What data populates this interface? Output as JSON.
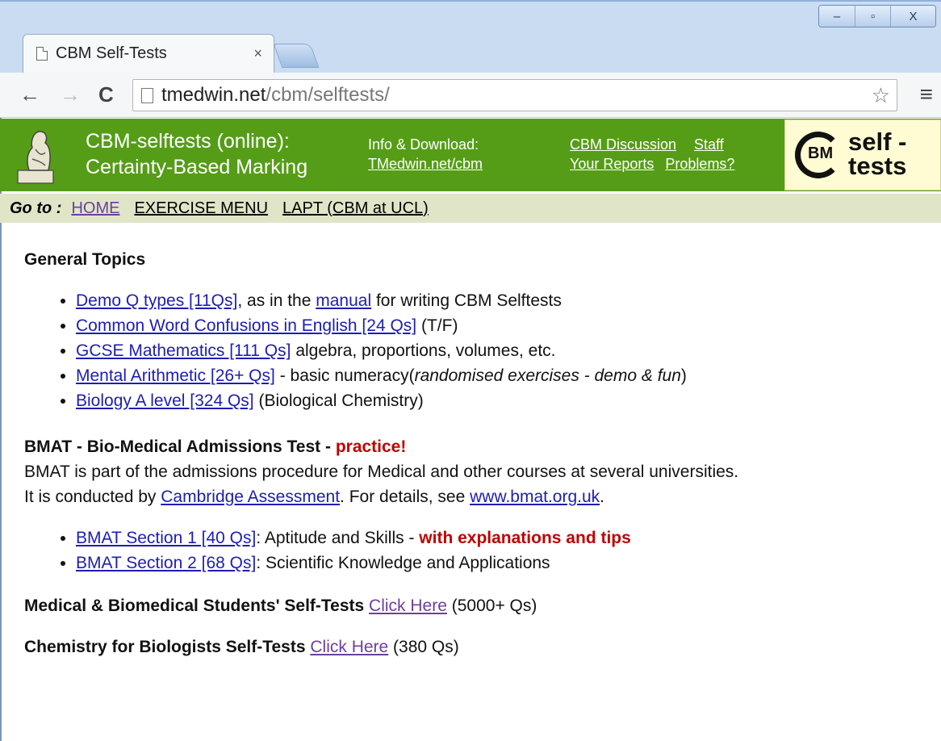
{
  "browser": {
    "tab_title": "CBM Self-Tests",
    "tab_close": "×",
    "url_host": "tmedwin.net",
    "url_path": "/cbm/selftests/",
    "window_controls": [
      "–",
      "▫",
      "X"
    ]
  },
  "header": {
    "title_line1": "CBM-selftests (online):",
    "title_line2": "Certainty-Based Marking",
    "info_label": "Info & Download:",
    "info_link": "TMedwin.net/cbm",
    "link_discussion": "CBM Discussion",
    "link_staff": "Staff",
    "link_reports": "Your Reports",
    "link_problems": "Problems?",
    "brand_bm": "BM",
    "brand_line1": "self -",
    "brand_line2": "tests"
  },
  "goto": {
    "label": "Go to :",
    "home": "HOME",
    "exercise_menu": "EXERCISE MENU",
    "lapt": "LAPT (CBM at UCL)"
  },
  "general": {
    "heading": "General Topics",
    "items": [
      {
        "link": "Demo Q types [11Qs]",
        "text1": ", as in the ",
        "link2": "manual",
        "text2": " for writing CBM Selftests"
      },
      {
        "link": "Common Word Confusions in English [24 Qs]",
        "text1": " (T/F)"
      },
      {
        "link": "GCSE Mathematics [111 Qs]",
        "text1": " algebra, proportions, volumes, etc."
      },
      {
        "link": "Mental Arithmetic [26+ Qs]",
        "text1": " - basic numeracy(",
        "italic": "randomised exercises - demo & fun",
        "text2": ")"
      },
      {
        "link": "Biology A level [324 Qs]",
        "text1": " (Biological Chemistry)"
      }
    ]
  },
  "bmat": {
    "heading": "BMAT - Bio-Medical Admissions Test - ",
    "heading_red": "practice!",
    "para_line1": "BMAT is part of the admissions procedure for Medical and other courses at several universities.",
    "para_line2_a": "It is conducted by ",
    "para_link1": "Cambridge Assessment",
    "para_line2_b": ". For details, see ",
    "para_link2": "www.bmat.org.uk",
    "para_line2_c": ".",
    "items": [
      {
        "link": "BMAT Section 1 [40 Qs]",
        "text1": ": Aptitude and Skills - ",
        "red": " with explanations and tips"
      },
      {
        "link": "BMAT Section 2 [68 Qs]",
        "text1": ": Scientific Knowledge and Applications"
      }
    ]
  },
  "medical": {
    "heading": "Medical & Biomedical Students' Self-Tests",
    "link": "Click Here",
    "count": " (5000+ Qs)"
  },
  "chemistry": {
    "heading": "Chemistry for Biologists Self-Tests",
    "link": "Click Here",
    "count": " (380 Qs)"
  }
}
